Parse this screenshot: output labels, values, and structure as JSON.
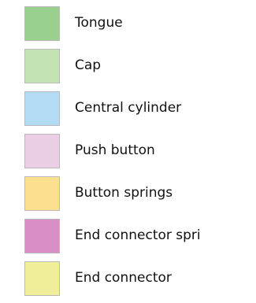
{
  "legend": {
    "items": [
      {
        "label": "Tongue",
        "color": "#99d08e"
      },
      {
        "label": "Cap",
        "color": "#c3e3b4"
      },
      {
        "label": "Central cylinder",
        "color": "#b3dbf4"
      },
      {
        "label": "Push button",
        "color": "#eacfe4"
      },
      {
        "label": "Button springs",
        "color": "#fbe08f"
      },
      {
        "label": "End connector spri",
        "color": "#d88ec4"
      },
      {
        "label": "End connector",
        "color": "#f1ee9b"
      }
    ]
  }
}
